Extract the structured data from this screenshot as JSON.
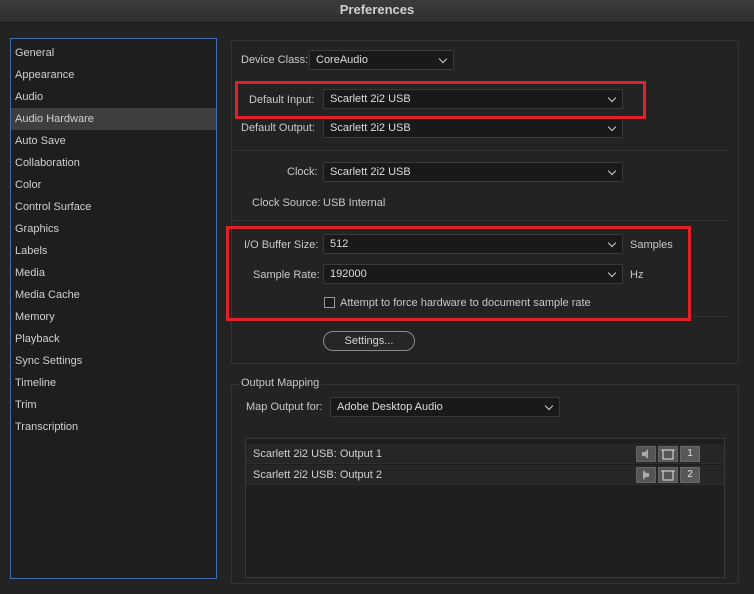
{
  "window": {
    "title": "Preferences"
  },
  "sidebar": {
    "items": [
      {
        "label": "General"
      },
      {
        "label": "Appearance"
      },
      {
        "label": "Audio"
      },
      {
        "label": "Audio Hardware"
      },
      {
        "label": "Auto Save"
      },
      {
        "label": "Collaboration"
      },
      {
        "label": "Color"
      },
      {
        "label": "Control Surface"
      },
      {
        "label": "Graphics"
      },
      {
        "label": "Labels"
      },
      {
        "label": "Media"
      },
      {
        "label": "Media Cache"
      },
      {
        "label": "Memory"
      },
      {
        "label": "Playback"
      },
      {
        "label": "Sync Settings"
      },
      {
        "label": "Timeline"
      },
      {
        "label": "Trim"
      },
      {
        "label": "Transcription"
      }
    ],
    "selected": "Audio Hardware"
  },
  "audio_hardware": {
    "device_class_label": "Device Class:",
    "device_class_value": "CoreAudio",
    "default_input_label": "Default Input:",
    "default_input_value": "Scarlett 2i2 USB",
    "default_output_label": "Default Output:",
    "default_output_value": "Scarlett 2i2 USB",
    "clock_label": "Clock:",
    "clock_value": "Scarlett 2i2 USB",
    "clock_source_label": "Clock Source:",
    "clock_source_value": "USB Internal",
    "buffer_label": "I/O Buffer Size:",
    "buffer_value": "512",
    "buffer_unit": "Samples",
    "sample_rate_label": "Sample Rate:",
    "sample_rate_value": "192000",
    "sample_rate_unit": "Hz",
    "force_rate_label": "Attempt to force hardware to document sample rate",
    "force_rate_checked": false,
    "settings_button": "Settings..."
  },
  "output_mapping": {
    "section_title": "Output Mapping",
    "map_output_label": "Map Output for:",
    "map_output_value": "Adobe Desktop Audio",
    "outputs": [
      {
        "name": "Scarlett 2i2 USB: Output 1",
        "channel": "1",
        "icon": "speaker-left-icon"
      },
      {
        "name": "Scarlett 2i2 USB: Output 2",
        "channel": "2",
        "icon": "speaker-right-icon"
      }
    ]
  },
  "colors": {
    "highlight_box": "#e0202b",
    "sidebar_border": "#3f6fae"
  }
}
